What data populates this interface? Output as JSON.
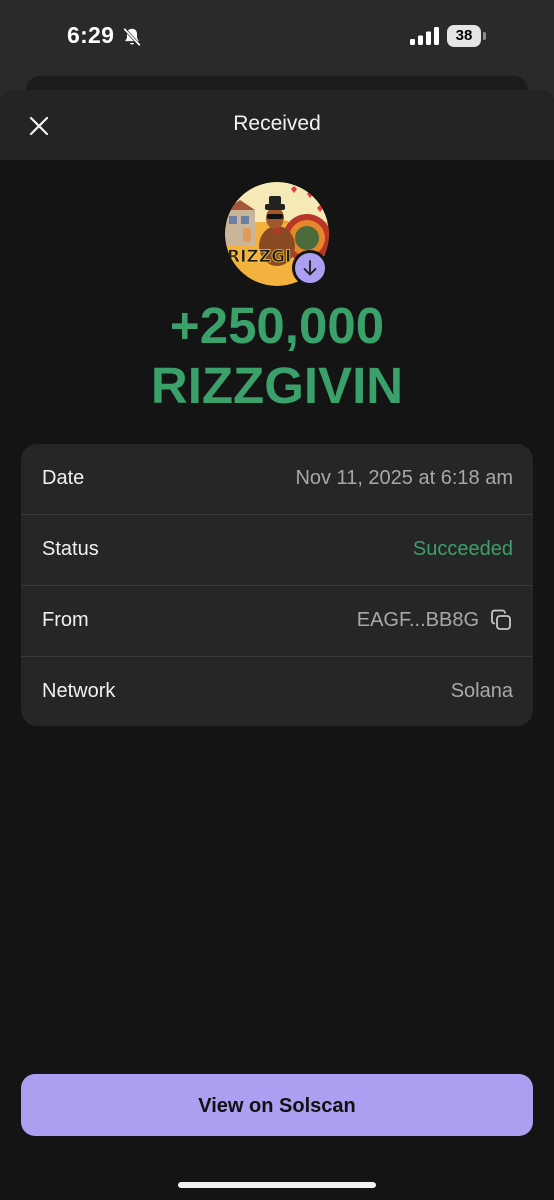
{
  "status_bar": {
    "time": "6:29",
    "battery": "38",
    "icons": [
      "bell-slash-icon",
      "cellular-signal-icon",
      "battery-icon"
    ]
  },
  "header": {
    "title": "Received",
    "close_icon": "close-icon"
  },
  "token": {
    "avatar_icon": "token-logo-rizzgivin",
    "badge_icon": "arrow-down-icon",
    "amount": "+250,000",
    "symbol": "RIZZGIVIN"
  },
  "details": [
    {
      "label": "Date",
      "value": "Nov 11, 2025 at 6:18 am"
    },
    {
      "label": "Status",
      "value": "Succeeded"
    },
    {
      "label": "From",
      "value": "EAGF...BB8G"
    },
    {
      "label": "Network",
      "value": "Solana"
    }
  ],
  "actions": {
    "view_button": "View on Solscan"
  },
  "colors": {
    "accent": "#aa9ff0",
    "success": "#3aa16a",
    "sheet_background": "#141414",
    "card_background": "#262626"
  }
}
